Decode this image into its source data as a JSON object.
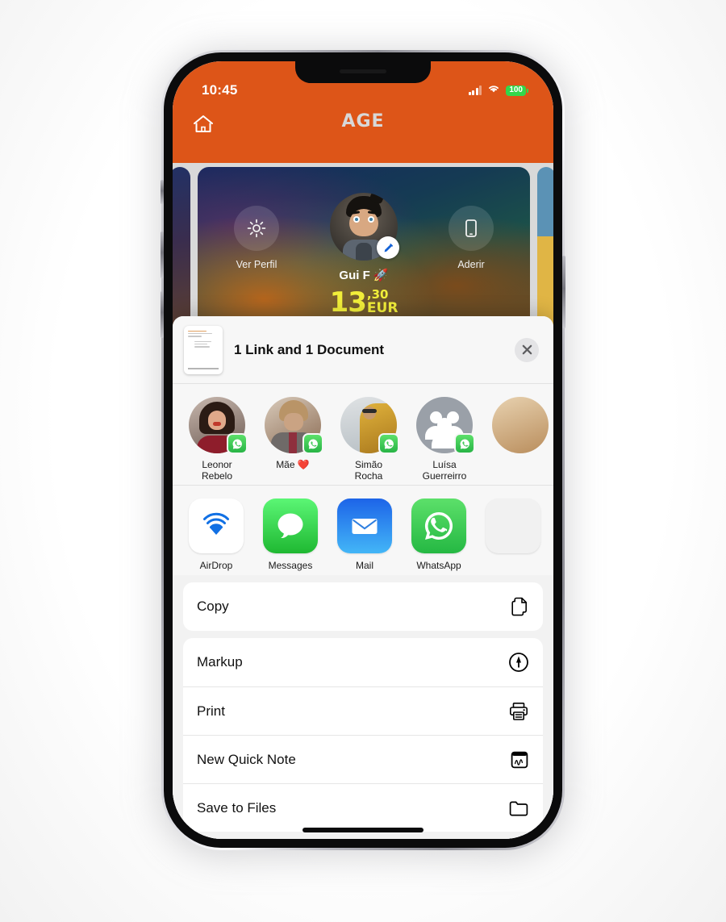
{
  "status_bar": {
    "time": "10:45",
    "cellular_icon": "signal-bars-icon",
    "wifi_icon": "wifi-icon",
    "battery_level": "100"
  },
  "app_header": {
    "home_icon": "home-icon",
    "brand": "AGE",
    "bar_color": "#dd5518"
  },
  "profile_card": {
    "left_action": {
      "label": "Ver Perfil",
      "icon": "gear-icon"
    },
    "right_action": {
      "label": "Aderir",
      "icon": "mobile-phone-icon"
    },
    "avatar_icon": "user-avatar",
    "edit_badge_icon": "pencil-edit-icon",
    "name": "Gui F 🚀",
    "balance_integer": "13",
    "balance_cents": ",30",
    "balance_currency": "EUR",
    "balance_color": "#f2ef3a"
  },
  "share_sheet": {
    "header": {
      "title": "1 Link and 1 Document",
      "thumbnail_icon": "document-thumbnail",
      "close_icon": "close-icon"
    },
    "contacts": [
      {
        "name": "Leonor\nRebelo",
        "line1": "Leonor",
        "line2": "Rebelo",
        "app_badge": "whatsapp-icon",
        "avatar_type": "photo"
      },
      {
        "name": "Mãe ❤️",
        "line1": "Mãe ❤️",
        "line2": "",
        "app_badge": "whatsapp-icon",
        "avatar_type": "photo"
      },
      {
        "name": "Simão Rocha",
        "line1": "Simão",
        "line2": "Rocha",
        "app_badge": "whatsapp-icon",
        "avatar_type": "photo"
      },
      {
        "name": "Luísa Guerreirro",
        "line1": "Luísa",
        "line2": "Guerreirro",
        "app_badge": "whatsapp-icon",
        "avatar_type": "group"
      }
    ],
    "apps": [
      {
        "label": "AirDrop",
        "icon": "airdrop-icon"
      },
      {
        "label": "Messages",
        "icon": "messages-icon"
      },
      {
        "label": "Mail",
        "icon": "mail-icon"
      },
      {
        "label": "WhatsApp",
        "icon": "whatsapp-icon"
      }
    ],
    "actions_group_1": [
      {
        "label": "Copy",
        "icon": "copy-icon"
      }
    ],
    "actions_group_2": [
      {
        "label": "Markup",
        "icon": "markup-pen-icon"
      },
      {
        "label": "Print",
        "icon": "printer-icon"
      },
      {
        "label": "New Quick Note",
        "icon": "quick-note-icon"
      },
      {
        "label": "Save to Files",
        "icon": "folder-icon"
      }
    ]
  }
}
